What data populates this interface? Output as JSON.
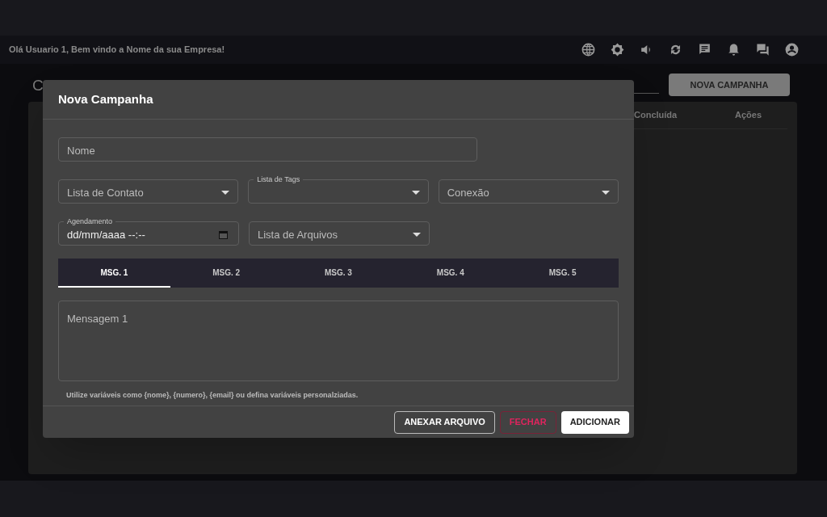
{
  "header": {
    "greeting": "Olá Usuario 1, Bem vindo a Nome da sua Empresa!"
  },
  "background_page": {
    "title_fragment": "C",
    "new_button": "NOVA CAMPANHA",
    "columns": [
      "Concluída",
      "Ações"
    ]
  },
  "dialog": {
    "title": "Nova Campanha",
    "rows": [
      [
        {
          "kind": "text",
          "placeholder": "Nome"
        }
      ],
      [
        {
          "kind": "select",
          "placeholder": "Lista de Contato"
        },
        {
          "kind": "select",
          "label": "Lista de Tags"
        },
        {
          "kind": "select",
          "placeholder": "Conexão"
        }
      ],
      [
        {
          "kind": "datetime",
          "label": "Agendamento",
          "value": "dd/mm/aaaa --:--"
        },
        {
          "kind": "select",
          "placeholder": "Lista de Arquivos"
        }
      ]
    ],
    "tabs": [
      {
        "label": "MSG. 1",
        "selected": true
      },
      {
        "label": "MSG. 2",
        "selected": false
      },
      {
        "label": "MSG. 3",
        "selected": false
      },
      {
        "label": "MSG. 4",
        "selected": false
      },
      {
        "label": "MSG. 5",
        "selected": false
      }
    ],
    "message": {
      "placeholder": "Mensagem 1"
    },
    "helper": "Utilize variáveis como {nome}, {numero}, {email} ou defina variáveis personalziadas.",
    "buttons": [
      {
        "label": "ANEXAR ARQUIVO",
        "kind": "outlined"
      },
      {
        "label": "FECHAR",
        "kind": "danger"
      },
      {
        "label": "ADICIONAR",
        "kind": "primary"
      }
    ]
  }
}
